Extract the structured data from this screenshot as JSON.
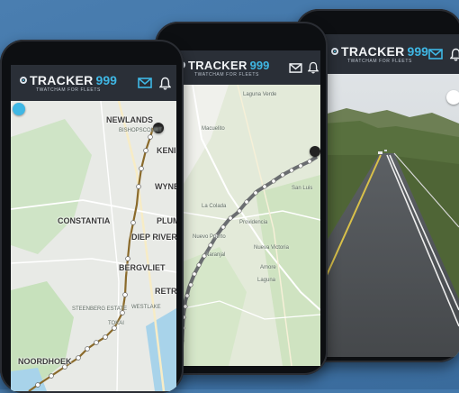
{
  "brand": {
    "name": "TRACKER",
    "number": "999",
    "tagline": "TWATCHAM FOR FLEETS"
  },
  "header_icons": [
    "mail-icon",
    "bell-icon"
  ],
  "colors": {
    "background": "#4279ad",
    "header": "#2a2f37",
    "brand_accent": "#3fb7e4",
    "route": "#8a6a2a",
    "map_green": "#c9e3c2",
    "water": "#9fd0e8"
  },
  "phone1": {
    "map_labels": [
      "NEWLANDS",
      "KENILWORTH",
      "WYNBERG",
      "CONSTANTIA",
      "PLUMSTEAD",
      "DIEP RIVER",
      "BERGVLIET",
      "RETREAT",
      "NOORDHOEK"
    ],
    "small_labels": [
      "BISHOPSCOURT",
      "TOKAI",
      "STEENBERG ESTATE",
      "WESTLAKE"
    ]
  },
  "phone2": {
    "map_labels": [
      "Laguna Verde",
      "Macuelito",
      "San Luis",
      "Providencia",
      "Nueva Victoria",
      "Naranjal",
      "Laguna",
      "Amore"
    ],
    "route_labels": [
      "Nuevo Puerto",
      "La Colada"
    ]
  },
  "phone3": {
    "view": "street-view"
  }
}
